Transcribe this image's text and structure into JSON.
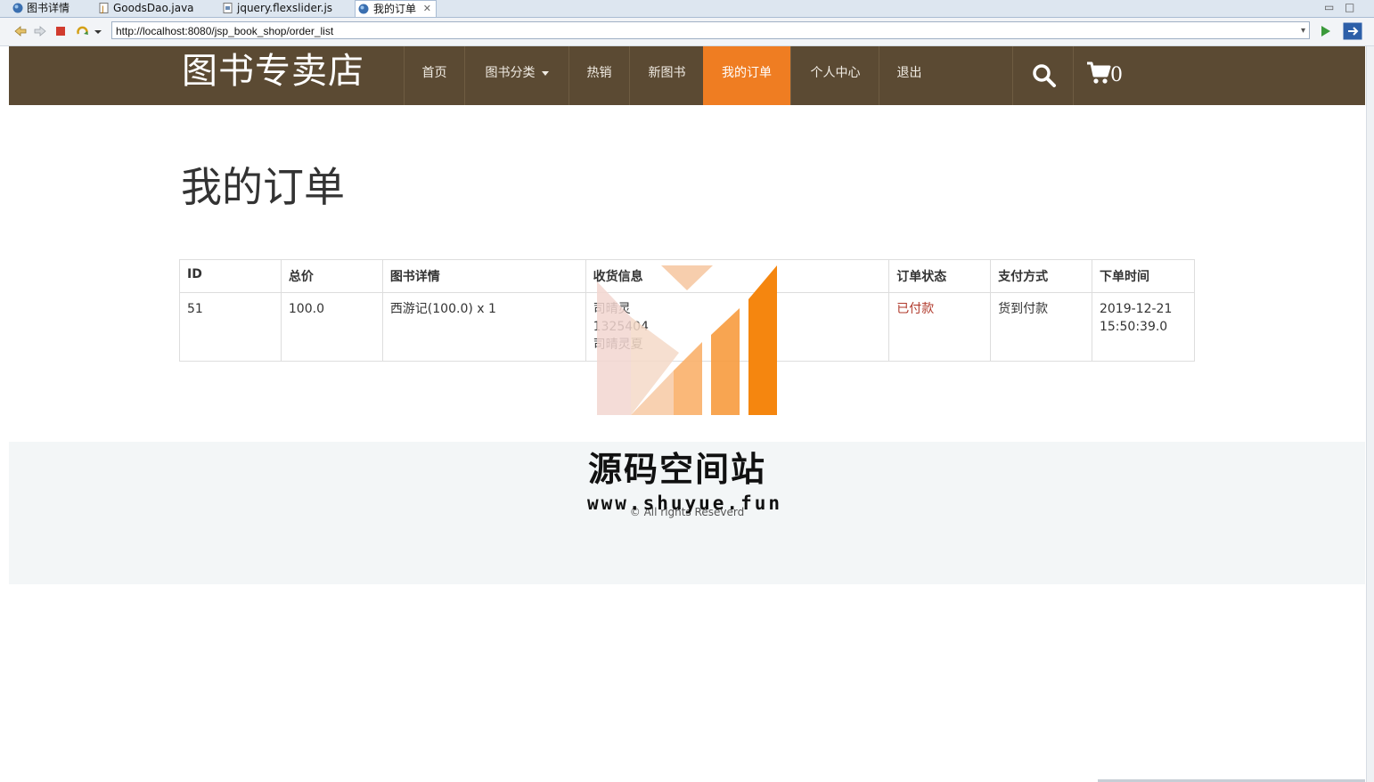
{
  "ide_tabs": [
    {
      "label": "图书详情",
      "icon": "globe-icon"
    },
    {
      "label": "GoodsDao.java",
      "icon": "java-file-icon"
    },
    {
      "label": "jquery.flexslider.js",
      "icon": "js-file-icon"
    },
    {
      "label": "我的订单",
      "icon": "globe-icon",
      "active": true
    }
  ],
  "browser": {
    "url": "http://localhost:8080/jsp_book_shop/order_list"
  },
  "navbar": {
    "brand": "图书专卖店",
    "items": [
      {
        "label": "首页"
      },
      {
        "label": "图书分类",
        "dropdown": true
      },
      {
        "label": "热销"
      },
      {
        "label": "新图书"
      },
      {
        "label": "我的订单",
        "active": true
      },
      {
        "label": "个人中心"
      },
      {
        "label": "退出"
      }
    ],
    "cart_count": "0",
    "colors": {
      "bar": "#5b4a33",
      "active": "#ef7d22"
    }
  },
  "main": {
    "title": "我的订单",
    "table": {
      "headers": [
        "ID",
        "总价",
        "图书详情",
        "收货信息",
        "订单状态",
        "支付方式",
        "下单时间"
      ],
      "rows": [
        {
          "id": "51",
          "total": "100.0",
          "detail": "西游记(100.0) x 1",
          "receiver_line1": "司晴灵",
          "receiver_line2": "1325404",
          "receiver_line3": "司晴灵夏",
          "status": "已付款",
          "payment": "货到付款",
          "time_date": "2019-12-21",
          "time_clock": "15:50:39.0"
        }
      ]
    }
  },
  "footer": {
    "copyright": "© All rights Reseverd"
  },
  "watermark": {
    "title": "源码空间站",
    "url": "www.shuyue.fun"
  }
}
